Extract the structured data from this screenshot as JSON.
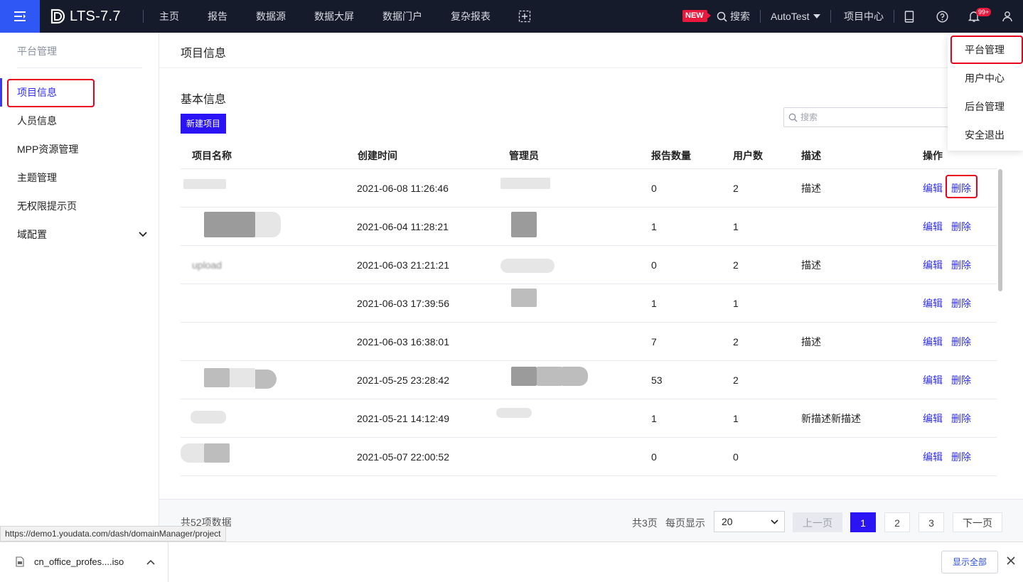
{
  "topbar": {
    "app_title": "LTS-7.7",
    "nav": [
      "主页",
      "报告",
      "数据源",
      "数据大屏",
      "数据门户",
      "复杂报表"
    ],
    "new_badge": "NEW",
    "search_label": "搜索",
    "user_name": "AutoTest",
    "project_center": "项目中心",
    "bell_count": "99+",
    "colors": {
      "bar_bg": "#151b2b",
      "menu_btn_bg": "#2f57f5",
      "badge": "#e8193c"
    }
  },
  "sidebar": {
    "title": "平台管理",
    "items": [
      {
        "label": "项目信息",
        "active": true
      },
      {
        "label": "人员信息"
      },
      {
        "label": "MPP资源管理"
      },
      {
        "label": "主题管理"
      },
      {
        "label": "无权限提示页"
      },
      {
        "label": "域配置",
        "expandable": true
      }
    ]
  },
  "main": {
    "page_title": "项目信息",
    "section_title": "基本信息",
    "new_project_button": "新建项目",
    "search_placeholder": "搜索",
    "table": {
      "columns": [
        "项目名称",
        "创建时间",
        "管理员",
        "报告数量",
        "用户数",
        "描述",
        "操作"
      ],
      "edit_label": "编辑",
      "delete_label": "删除",
      "rows": [
        {
          "created": "2021-06-08 11:26:46",
          "reports": "0",
          "users": "2",
          "desc": "描述"
        },
        {
          "created": "2021-06-04 11:28:21",
          "reports": "1",
          "users": "1",
          "desc": ""
        },
        {
          "name": "upload",
          "created": "2021-06-03 21:21:21",
          "reports": "0",
          "users": "2",
          "desc": "描述"
        },
        {
          "created": "2021-06-03 17:39:56",
          "reports": "1",
          "users": "1",
          "desc": ""
        },
        {
          "created": "2021-06-03 16:38:01",
          "reports": "7",
          "users": "2",
          "desc": "描述"
        },
        {
          "created": "2021-05-25 23:28:42",
          "reports": "53",
          "users": "2",
          "desc": ""
        },
        {
          "created": "2021-05-21 14:12:49",
          "reports": "1",
          "users": "1",
          "desc": "新描述新描述"
        },
        {
          "created": "2021-05-07 22:00:52",
          "reports": "0",
          "users": "0",
          "desc": ""
        }
      ]
    },
    "footer": {
      "total": "共52项数据",
      "pages_total": "共3页",
      "per_page_label": "每页显示",
      "per_page_value": "20",
      "prev": "上一页",
      "next": "下一页",
      "pages": [
        "1",
        "2",
        "3"
      ],
      "current_page": "1"
    }
  },
  "user_menu": {
    "items": [
      "平台管理",
      "用户中心",
      "后台管理",
      "安全退出"
    ]
  },
  "status_bar": {
    "url": "https://demo1.youdata.com/dash/domainManager/project"
  },
  "download_bar": {
    "file_name": "cn_office_profes....iso",
    "show_all": "显示全部"
  }
}
